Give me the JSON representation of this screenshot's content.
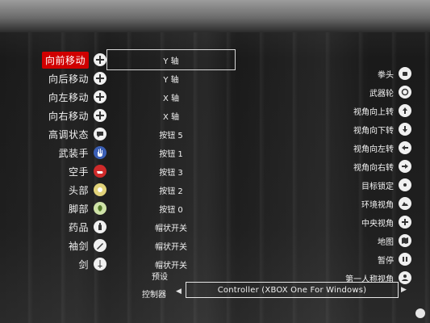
{
  "left_actions": [
    {
      "label": "向前移动",
      "binding": "Y 轴",
      "icon": "dpad-icon"
    },
    {
      "label": "向后移动",
      "binding": "Y 轴",
      "icon": "dpad-icon"
    },
    {
      "label": "向左移动",
      "binding": "X 轴",
      "icon": "dpad-icon"
    },
    {
      "label": "向右移动",
      "binding": "X 轴",
      "icon": "dpad-icon"
    },
    {
      "label": "高调状态",
      "binding": "按钮 5",
      "icon": "speech-bubble-icon"
    },
    {
      "label": "武装手",
      "binding": "按钮 1",
      "icon": "hand-icon"
    },
    {
      "label": "空手",
      "binding": "按钮 3",
      "icon": "hand-icon"
    },
    {
      "label": "头部",
      "binding": "按钮 2",
      "icon": "head-icon"
    },
    {
      "label": "脚部",
      "binding": "按钮 0",
      "icon": "leaf-icon"
    },
    {
      "label": "药品",
      "binding": "帽状开关",
      "icon": "bottle-icon"
    },
    {
      "label": "袖剑",
      "binding": "帽状开关",
      "icon": "blade-icon"
    },
    {
      "label": "剑",
      "binding": "帽状开关",
      "icon": "sword-icon"
    }
  ],
  "right_actions": [
    {
      "label": "拳头",
      "icon": "fist-icon"
    },
    {
      "label": "武器轮",
      "icon": "weapon-wheel-icon"
    },
    {
      "label": "视角向上转",
      "icon": "arrow-up-icon"
    },
    {
      "label": "视角向下转",
      "icon": "arrow-down-icon"
    },
    {
      "label": "视角向左转",
      "icon": "arrow-left-icon"
    },
    {
      "label": "视角向右转",
      "icon": "arrow-right-icon"
    },
    {
      "label": "目标锁定",
      "icon": "target-lock-icon"
    },
    {
      "label": "环境视角",
      "icon": "environment-icon"
    },
    {
      "label": "中央视角",
      "icon": "center-view-icon"
    },
    {
      "label": "地图",
      "icon": "map-icon"
    },
    {
      "label": "暂停",
      "icon": "pause-icon"
    },
    {
      "label": "第一人称视角",
      "icon": "first-person-icon"
    }
  ],
  "preset_label": "预设",
  "controller_label": "控制器",
  "controller_value": "Controller (XBOX One For Windows)",
  "arrow_left": "◀",
  "arrow_right": "▶",
  "selected_index": 0,
  "colors": {
    "highlight": "#d00000",
    "panel_bg": "#1e1e1e",
    "text": "#f2f2f2"
  }
}
